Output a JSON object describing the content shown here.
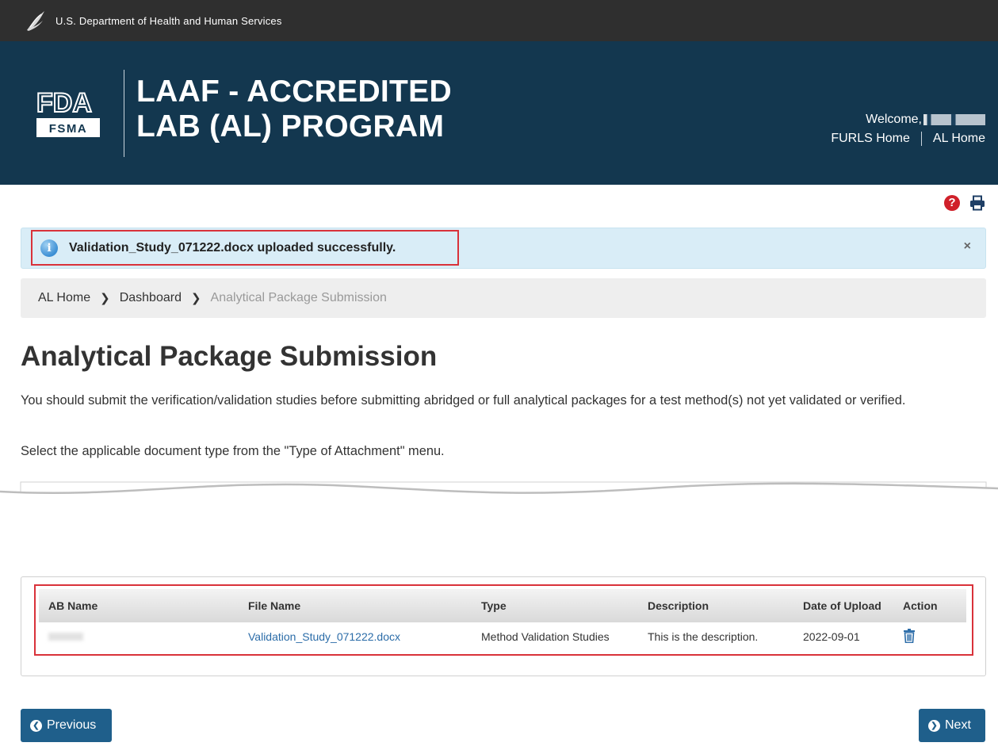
{
  "top_bar": {
    "agency": "U.S. Department of Health and Human Services"
  },
  "header": {
    "logo_top": "FDA",
    "logo_bottom": "FSMA",
    "title_line1": "LAAF - ACCREDITED",
    "title_line2": "LAB (AL) PROGRAM",
    "welcome": "Welcome,",
    "links": [
      "FURLS Home",
      "AL Home"
    ]
  },
  "tools": {
    "help_icon": "question-circle-icon",
    "print_icon": "print-icon"
  },
  "alert": {
    "message": "Validation_Study_071222.docx uploaded successfully.",
    "close": "×"
  },
  "breadcrumb": {
    "items": [
      "AL Home",
      "Dashboard"
    ],
    "current": "Analytical Package Submission"
  },
  "page": {
    "title": "Analytical Package Submission",
    "intro": "You should submit the verification/validation studies before submitting abridged or full analytical packages for a test method(s) not yet validated or verified.",
    "instruction": "Select the applicable document type from the \"Type of Attachment\" menu."
  },
  "table": {
    "headers": [
      "AB Name",
      "File Name",
      "Type",
      "Description",
      "Date of Upload",
      "Action"
    ],
    "rows": [
      {
        "ab_name": "",
        "file_name": "Validation_Study_071222.docx",
        "type": "Method Validation Studies",
        "description": "This is the description.",
        "date": "2022-09-01",
        "action_icon": "trash-icon"
      }
    ]
  },
  "nav": {
    "previous": "Previous",
    "next": "Next"
  }
}
